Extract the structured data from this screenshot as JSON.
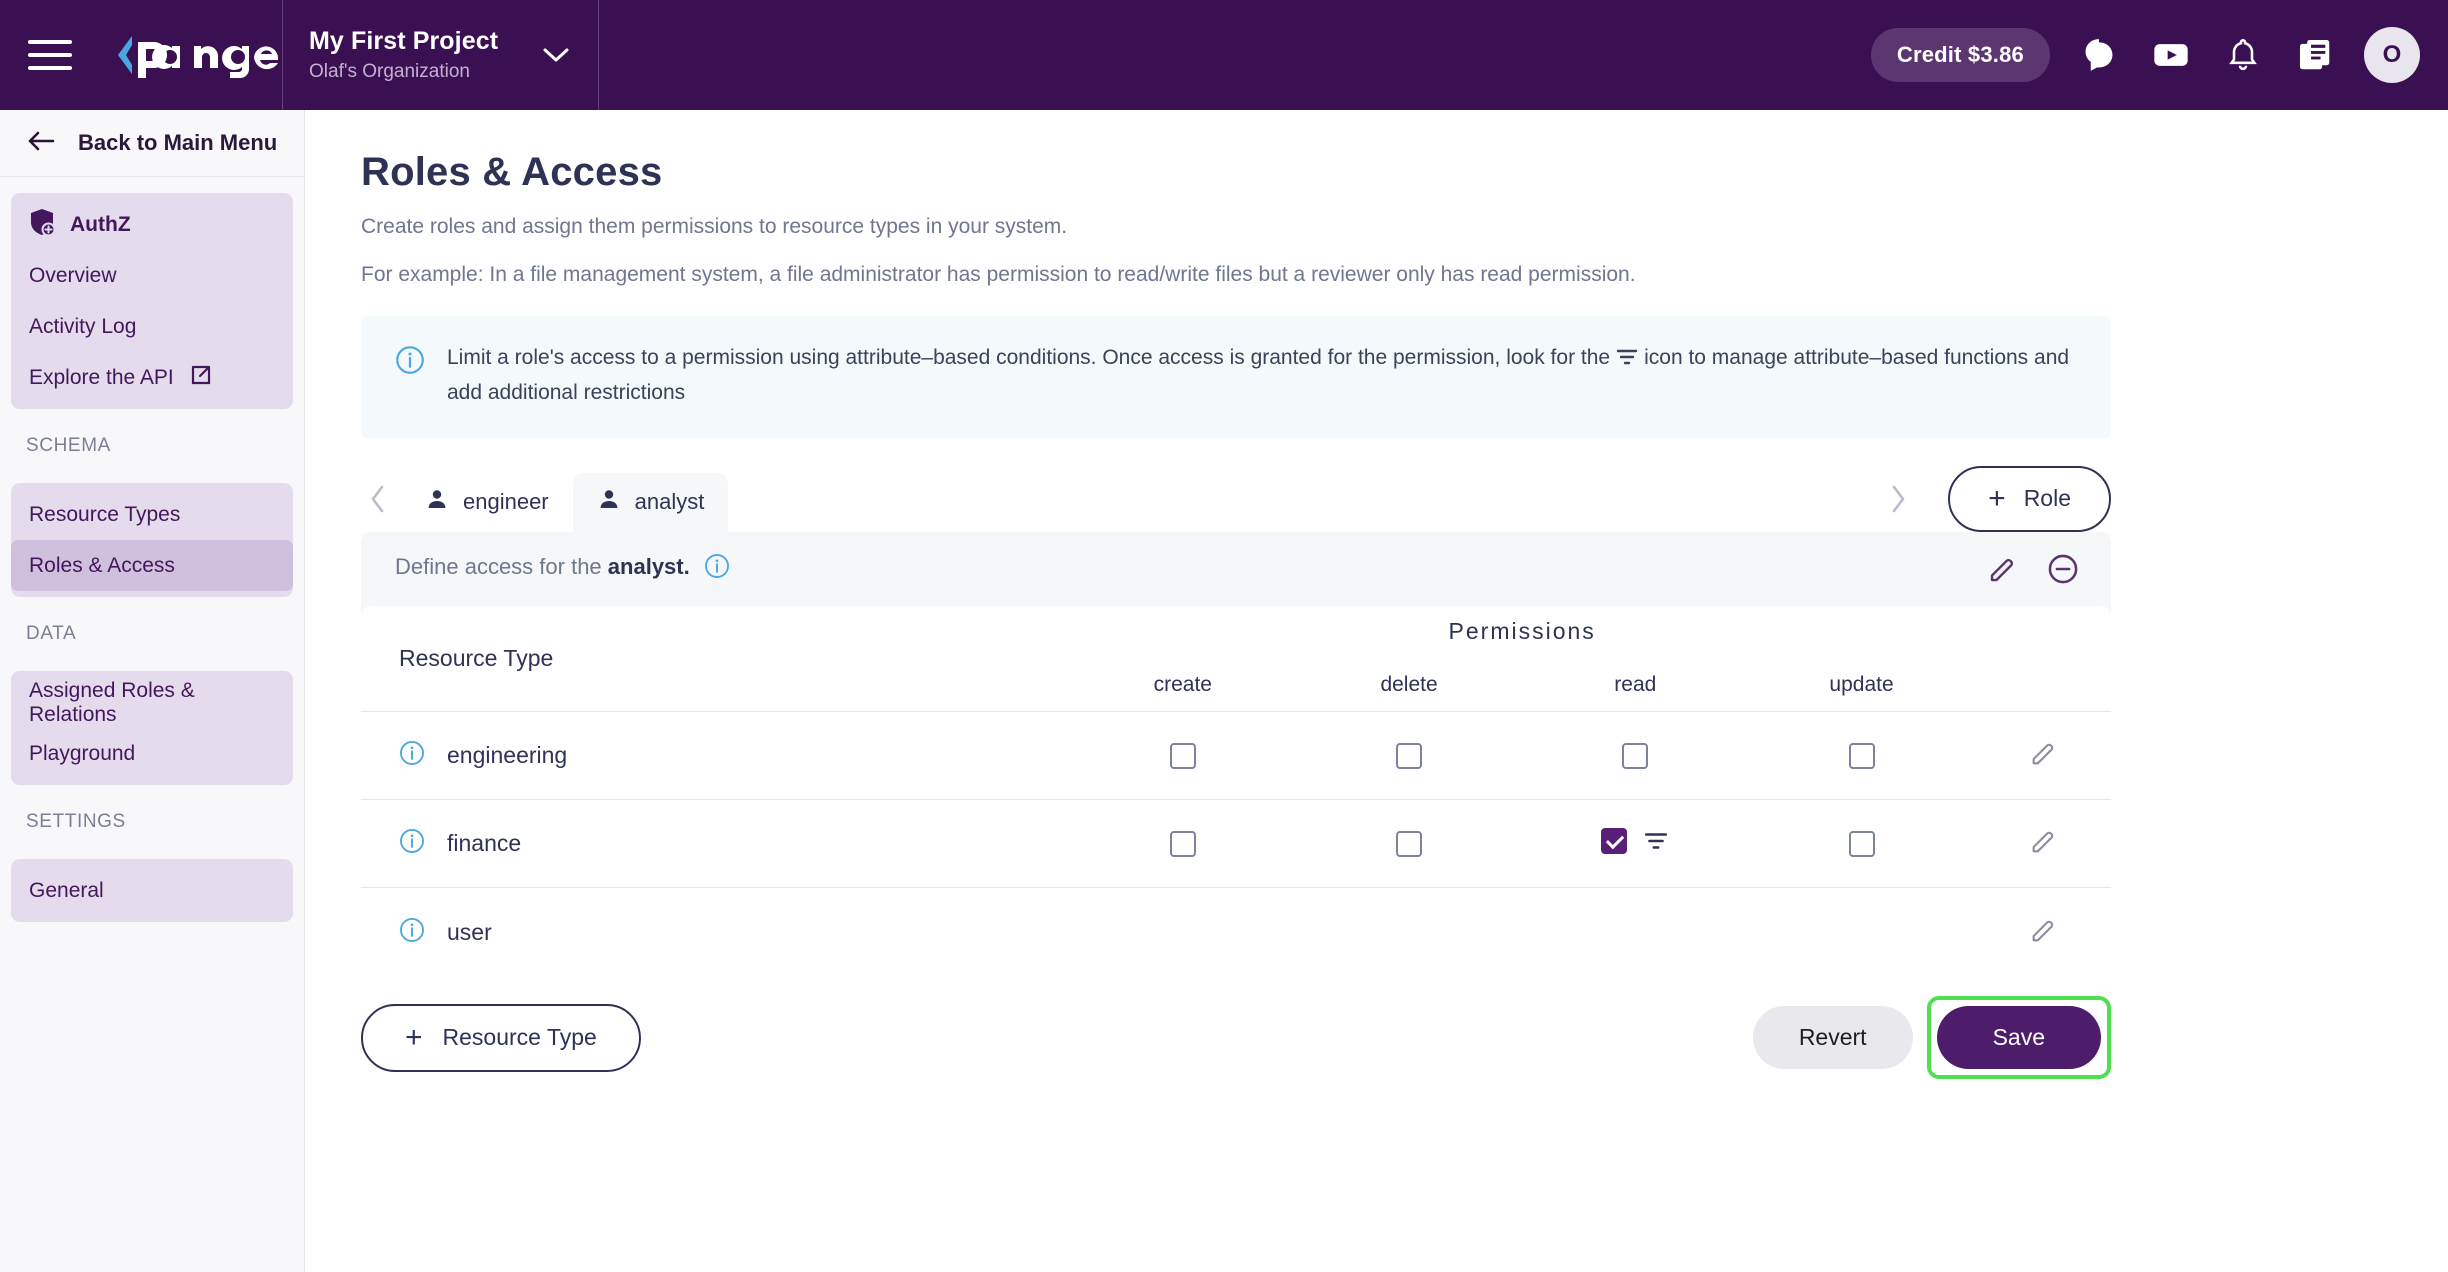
{
  "topbar": {
    "menu_icon": "hamburger-menu-icon",
    "logo_text": "pangea",
    "project_title": "My First Project",
    "project_org": "Olaf's Organization",
    "project_chevron": "chevron-down-icon",
    "credit_label": "Credit $3.86",
    "icons": [
      "chat-icon",
      "youtube-icon",
      "bell-icon",
      "docs-icon"
    ],
    "avatar_initial": "O"
  },
  "sidebar": {
    "back_label": "Back to Main Menu",
    "service": {
      "label": "AuthZ",
      "icon": "shield-plus-icon"
    },
    "items": [
      {
        "label": "Overview",
        "active": false
      },
      {
        "label": "Activity Log",
        "active": false
      },
      {
        "label": "Explore the API",
        "active": false,
        "icon": "external-link-icon"
      }
    ],
    "sections": [
      {
        "label": "SCHEMA",
        "items": [
          {
            "label": "Resource Types",
            "active": false
          },
          {
            "label": "Roles & Access",
            "active": true
          }
        ]
      },
      {
        "label": "DATA",
        "items": [
          {
            "label": "Assigned Roles & Relations",
            "active": false
          },
          {
            "label": "Playground",
            "active": false
          }
        ]
      },
      {
        "label": "SETTINGS",
        "items": [
          {
            "label": "General",
            "active": false
          }
        ]
      }
    ]
  },
  "main": {
    "title": "Roles & Access",
    "subtitle_1": "Create roles and assign them permissions to resource types in your system.",
    "subtitle_2": "For example: In a file management system, a file administrator has permission to read/write files but a reviewer only has read permission.",
    "callout": {
      "icon": "info-circle-icon",
      "text_before": "Limit a role's access to a permission using attribute–based conditions. Once access is granted for the permission, look for the",
      "text_after": "icon to manage attribute–based functions and add additional restrictions",
      "inline_icon": "filter-icon"
    },
    "tabs": {
      "prev_icon": "chevron-left-icon",
      "next_icon": "chevron-right-icon",
      "items": [
        {
          "label": "engineer",
          "icon": "person-icon",
          "active": false
        },
        {
          "label": "analyst",
          "icon": "person-icon",
          "active": true
        }
      ],
      "add_role_label": "Role",
      "add_role_plus": "+"
    },
    "panel": {
      "head_prefix": "Define access for the",
      "head_role": "analyst.",
      "head_info_icon": "info-circle-icon",
      "edit_icon": "pencil-icon",
      "remove_icon": "minus-circle-icon"
    },
    "table": {
      "resource_header": "Resource Type",
      "permissions_header": "Permissions",
      "permission_columns": [
        "create",
        "delete",
        "read",
        "update"
      ],
      "rows": [
        {
          "name": "engineering",
          "info_icon": "info-circle-icon",
          "has_permissions": true,
          "checks": [
            false,
            false,
            false,
            false
          ],
          "filters": [
            false,
            false,
            false,
            false
          ],
          "row_edit_icon": "pencil-icon"
        },
        {
          "name": "finance",
          "info_icon": "info-circle-icon",
          "has_permissions": true,
          "checks": [
            false,
            false,
            true,
            false
          ],
          "filters": [
            false,
            false,
            true,
            false
          ],
          "row_edit_icon": "pencil-icon"
        },
        {
          "name": "user",
          "info_icon": "info-circle-icon",
          "has_permissions": false,
          "checks": [],
          "filters": [],
          "row_edit_icon": "pencil-icon"
        }
      ]
    },
    "footer": {
      "add_resource_plus": "+",
      "add_resource_label": "Resource Type",
      "revert_label": "Revert",
      "save_label": "Save",
      "save_highlight_color": "#4ee04e"
    }
  },
  "colors": {
    "topbar_bg": "#3b1053",
    "accent_purple": "#4d1d6b",
    "sidebar_bg": "#f8f8fb",
    "nav_group_bg": "#e4dcec",
    "nav_active_bg": "#cfc0dd",
    "title_navy": "#2e3356",
    "callout_bg": "#f4f9fc",
    "info_blue": "#4aa8e0"
  }
}
